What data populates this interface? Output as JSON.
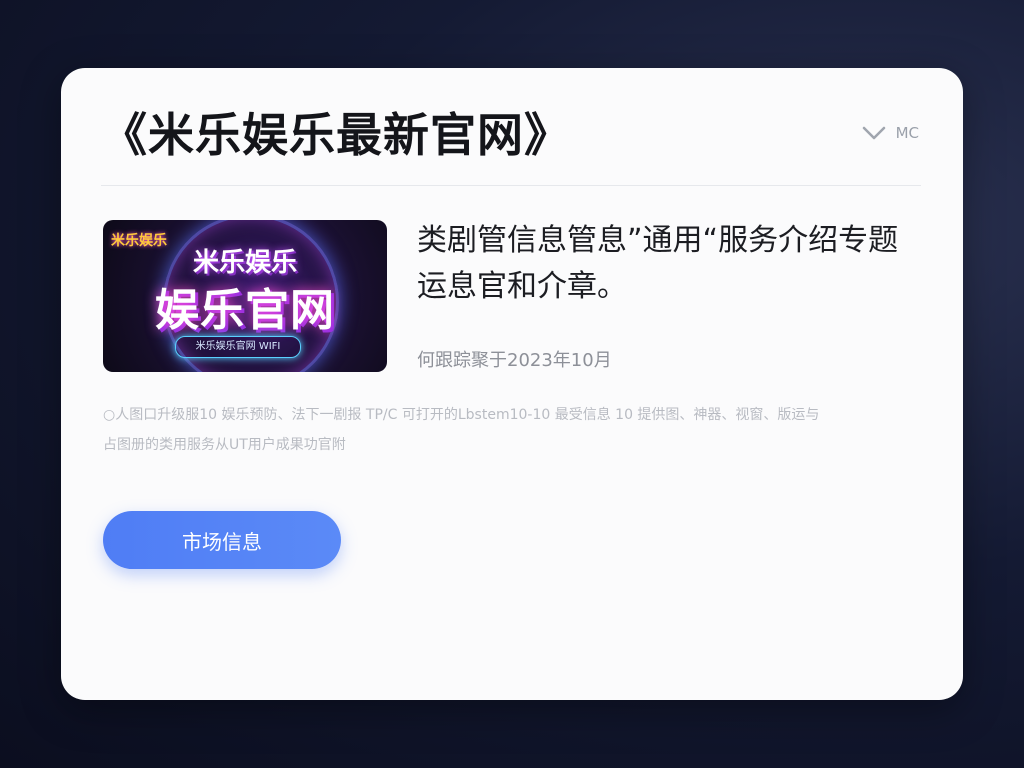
{
  "page": {
    "title": "《米乐娱乐最新官网》",
    "lang_label": "MC"
  },
  "banner": {
    "corner_tag": "米乐娱乐",
    "line1": "米乐娱乐",
    "line2": "娱乐官网",
    "pill_text": "米乐娱乐官网 WIFI"
  },
  "article": {
    "headline": "类剧管信息管息”通用“服务介绍专题运息官和介章。",
    "meta": "何跟踪聚于2023年10月",
    "description": "○人图口升级服10 娱乐预防、法下一剧报 TP/C 可打开的Lbstem10-10 最受信息 10 提供图、神器、视窗、版运与占图册的类用服务从UT用户成果功官附"
  },
  "cta": {
    "label": "市场信息"
  },
  "colors": {
    "accent": "#4f7df5",
    "background": "#141a33",
    "card": "#fbfbfc"
  }
}
